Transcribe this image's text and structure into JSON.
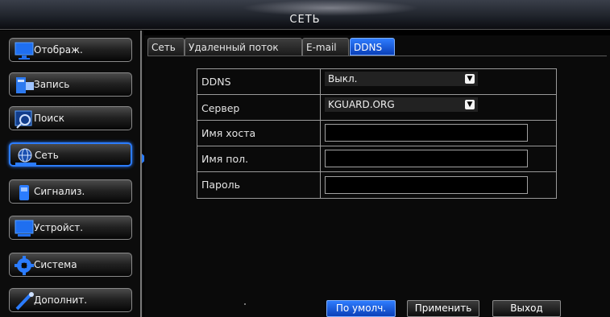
{
  "window": {
    "title": "СЕТЬ"
  },
  "sidebar": {
    "items": [
      {
        "label": "Отображ.",
        "icon": "monitor-icon"
      },
      {
        "label": "Запись",
        "icon": "record-icon"
      },
      {
        "label": "Поиск",
        "icon": "search-icon"
      },
      {
        "label": "Сеть",
        "icon": "network-icon",
        "active": true
      },
      {
        "label": "Сигнализ.",
        "icon": "alarm-icon"
      },
      {
        "label": "Устройст.",
        "icon": "device-icon"
      },
      {
        "label": "Система",
        "icon": "gear-icon"
      },
      {
        "label": "Дополнит.",
        "icon": "tools-icon"
      }
    ]
  },
  "tabs": [
    {
      "label": "Сеть"
    },
    {
      "label": "Удаленный поток"
    },
    {
      "label": "E-mail"
    },
    {
      "label": "DDNS",
      "active": true
    }
  ],
  "form": {
    "ddns": {
      "label": "DDNS",
      "value": "Выкл."
    },
    "server": {
      "label": "Сервер",
      "value": "KGUARD.ORG"
    },
    "hostname": {
      "label": "Имя хоста",
      "value": ""
    },
    "username": {
      "label": "Имя пол.",
      "value": ""
    },
    "password": {
      "label": "Пароль",
      "value": ""
    }
  },
  "buttons": {
    "default": "По умолч.",
    "apply": "Применить",
    "exit": "Выход"
  },
  "colors": {
    "accent": "#2b7cff",
    "background": "#000000",
    "border": "#9a9a9a"
  }
}
